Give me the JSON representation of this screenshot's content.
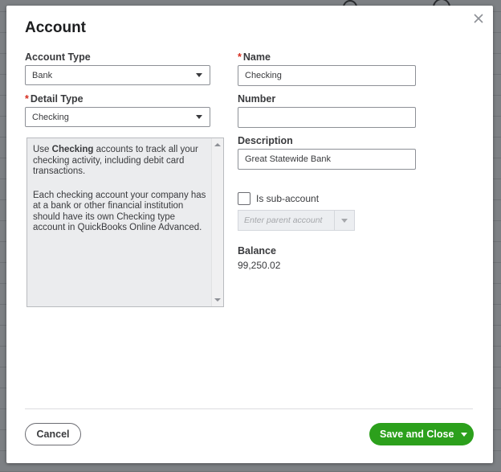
{
  "dialog": {
    "title": "Account",
    "close_icon": "close-icon"
  },
  "account_type": {
    "label": "Account Type",
    "value": "Bank"
  },
  "detail_type": {
    "required_mark": "*",
    "label": "Detail Type",
    "value": "Checking"
  },
  "help": {
    "paragraph1_prefix": "Use ",
    "paragraph1_bold": "Checking",
    "paragraph1_suffix": " accounts to track all your checking activity, including debit card transactions.",
    "paragraph2": "Each checking account your company has at a bank or other financial institution should have its own Checking type account in QuickBooks Online Advanced."
  },
  "name": {
    "required_mark": "*",
    "label": "Name",
    "value": "Checking"
  },
  "number": {
    "label": "Number",
    "value": ""
  },
  "description": {
    "label": "Description",
    "value": "Great Statewide Bank"
  },
  "sub_account": {
    "label": "Is sub-account",
    "checked": false,
    "parent_placeholder": "Enter parent account"
  },
  "balance": {
    "label": "Balance",
    "value": "99,250.02"
  },
  "footer": {
    "cancel_label": "Cancel",
    "save_label": "Save and Close"
  },
  "colors": {
    "primary_green": "#2ca01c",
    "required_red": "#d52b1e"
  }
}
